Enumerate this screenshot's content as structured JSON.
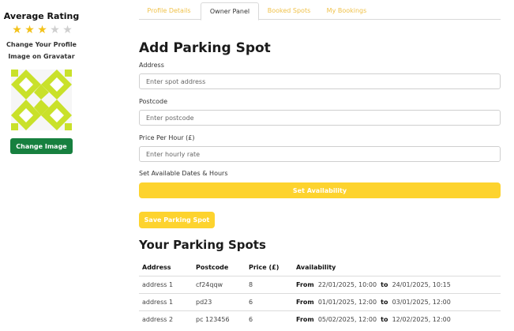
{
  "sidebar": {
    "average_rating_label": "Average Rating",
    "rating": 3,
    "rating_max": 5,
    "gravatar_text_line1": "Change Your Profile",
    "gravatar_text_line2": "Image on Gravatar",
    "change_image_label": "Change Image"
  },
  "tabs": [
    {
      "label": "Profile Details"
    },
    {
      "label": "Owner Panel"
    },
    {
      "label": "Booked Spots"
    },
    {
      "label": "My Bookings"
    }
  ],
  "form": {
    "title": "Add Parking Spot",
    "address_label": "Address",
    "address_placeholder": "Enter spot address",
    "postcode_label": "Postcode",
    "postcode_placeholder": "Enter postcode",
    "price_label": "Price Per Hour (£)",
    "price_placeholder": "Enter hourly rate",
    "availability_label": "Set Available Dates & Hours",
    "set_availability_label": "Set Availability",
    "save_label": "Save Parking Spot"
  },
  "spots": {
    "title": "Your Parking Spots",
    "headers": [
      "Address",
      "Postcode",
      "Price (£)",
      "Availability"
    ],
    "from_word": "From",
    "to_word": "to",
    "rows": [
      {
        "address": "address 1",
        "postcode": "cf24qqw",
        "price": "8",
        "from": "22/01/2025, 10:00",
        "to": "24/01/2025, 10:15"
      },
      {
        "address": "address 1",
        "postcode": "pd23",
        "price": "6",
        "from": "01/01/2025, 12:00",
        "to": "03/01/2025, 12:00"
      },
      {
        "address": "address 2",
        "postcode": "pc 123456",
        "price": "6",
        "from": "05/02/2025, 12:00",
        "to": "12/02/2025, 12:00"
      }
    ]
  },
  "colors": {
    "accent_yellow": "#fdd32e",
    "star_on": "#f3c21a",
    "change_image_green": "#17803f",
    "gravatar_green": "#c9e12a"
  }
}
